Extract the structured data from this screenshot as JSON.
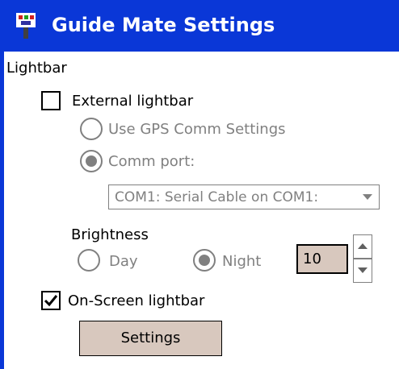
{
  "window": {
    "title": "Guide Mate Settings",
    "title_bar_color": "#0a37d7",
    "app_icon": "guide-mate-app-icon"
  },
  "lightbar": {
    "section_label": "Lightbar",
    "external_lightbar": {
      "label": "External lightbar",
      "checked": false
    },
    "use_gps_comm": {
      "label": "Use GPS Comm Settings",
      "selected": false,
      "enabled": false
    },
    "comm_port": {
      "label": "Comm port:",
      "selected": true,
      "enabled": false
    },
    "comm_port_select": {
      "value": "COM1: Serial Cable on COM1:",
      "enabled": false
    },
    "brightness": {
      "label": "Brightness",
      "day": {
        "label": "Day",
        "selected": false,
        "enabled": false
      },
      "night": {
        "label": "Night",
        "selected": true,
        "enabled": false
      },
      "value": "10"
    },
    "on_screen_lightbar": {
      "label": "On-Screen lightbar",
      "checked": true
    },
    "settings_button": "Settings"
  }
}
